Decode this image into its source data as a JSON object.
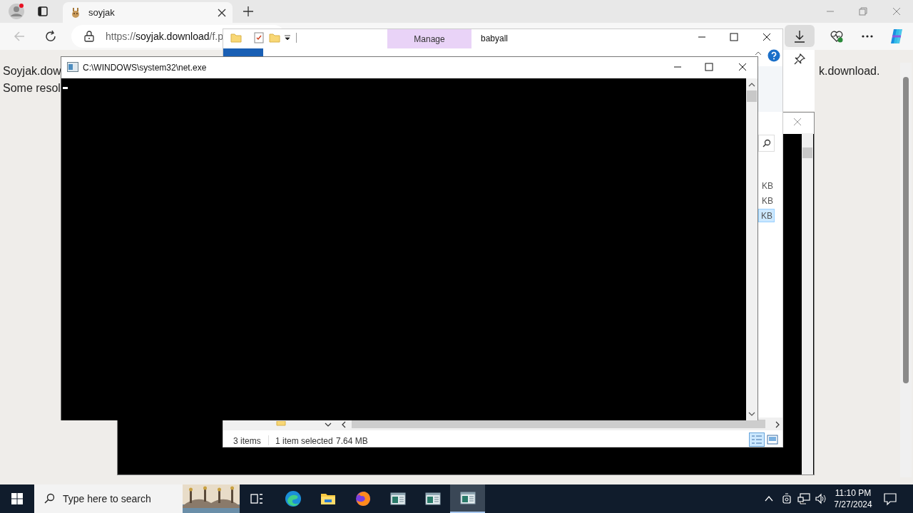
{
  "browser": {
    "tab_title": "soyjak",
    "address": {
      "scheme": "https://",
      "host": "soyjak.download",
      "path": "/f.p"
    },
    "page_text": [
      "Soyjak.dow",
      "Some resol",
      "k.download."
    ]
  },
  "explorer": {
    "title": "babyall",
    "contextual_tab": "Manage",
    "sizes": [
      {
        "text": "KB",
        "selected": false
      },
      {
        "text": "KB",
        "selected": false
      },
      {
        "text": "KB",
        "selected": true
      }
    ],
    "status": {
      "items": "3 items",
      "selection": "1 item selected",
      "size": "7.64 MB"
    }
  },
  "console": {
    "title": "C:\\WINDOWS\\system32\\net.exe"
  },
  "taskbar": {
    "search_placeholder": "Type here to search",
    "apps": [
      {
        "kind": "edge",
        "selected": false
      },
      {
        "kind": "folder",
        "selected": false
      },
      {
        "kind": "firefox",
        "selected": false
      },
      {
        "kind": "window",
        "selected": false
      },
      {
        "kind": "window",
        "selected": false
      },
      {
        "kind": "window",
        "selected": true
      }
    ],
    "time": "11:10 PM",
    "date": "7/27/2024"
  }
}
